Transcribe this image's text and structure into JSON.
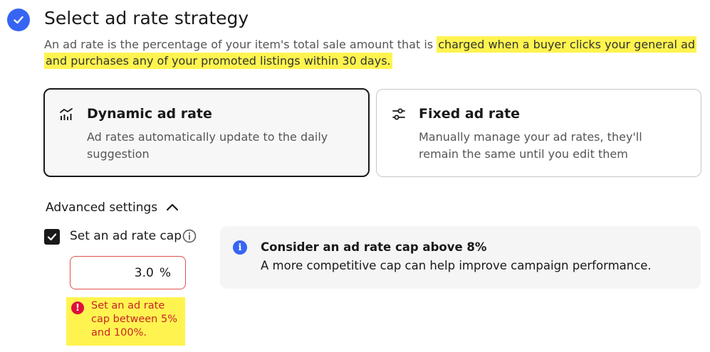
{
  "header": {
    "title": "Select ad rate strategy",
    "description_plain": "An ad rate is the percentage of your item's total sale amount that is",
    "description_highlighted": "charged when a buyer clicks your general ad and purchases any of your promoted listings within 30 days."
  },
  "strategies": [
    {
      "icon": "dynamic-rate-icon",
      "title": "Dynamic ad rate",
      "description": "Ad rates automatically update to the daily suggestion",
      "selected": true
    },
    {
      "icon": "sliders-icon",
      "title": "Fixed ad rate",
      "description": "Manually manage your ad rates, they'll remain the same until you edit them",
      "selected": false
    }
  ],
  "advanced": {
    "label": "Advanced settings",
    "expanded": true,
    "cap_checkbox_label": "Set an ad rate cap",
    "cap_checked": true,
    "cap_value": "3.0",
    "cap_unit": "%",
    "error_text": "Set an ad rate cap between 5% and 100%."
  },
  "notice": {
    "title": "Consider an ad rate cap above 8%",
    "text": "A more competitive cap can help improve campaign performance."
  },
  "colors": {
    "accent": "#3665f3",
    "highlight": "#fff44f",
    "error": "#c9242a"
  }
}
